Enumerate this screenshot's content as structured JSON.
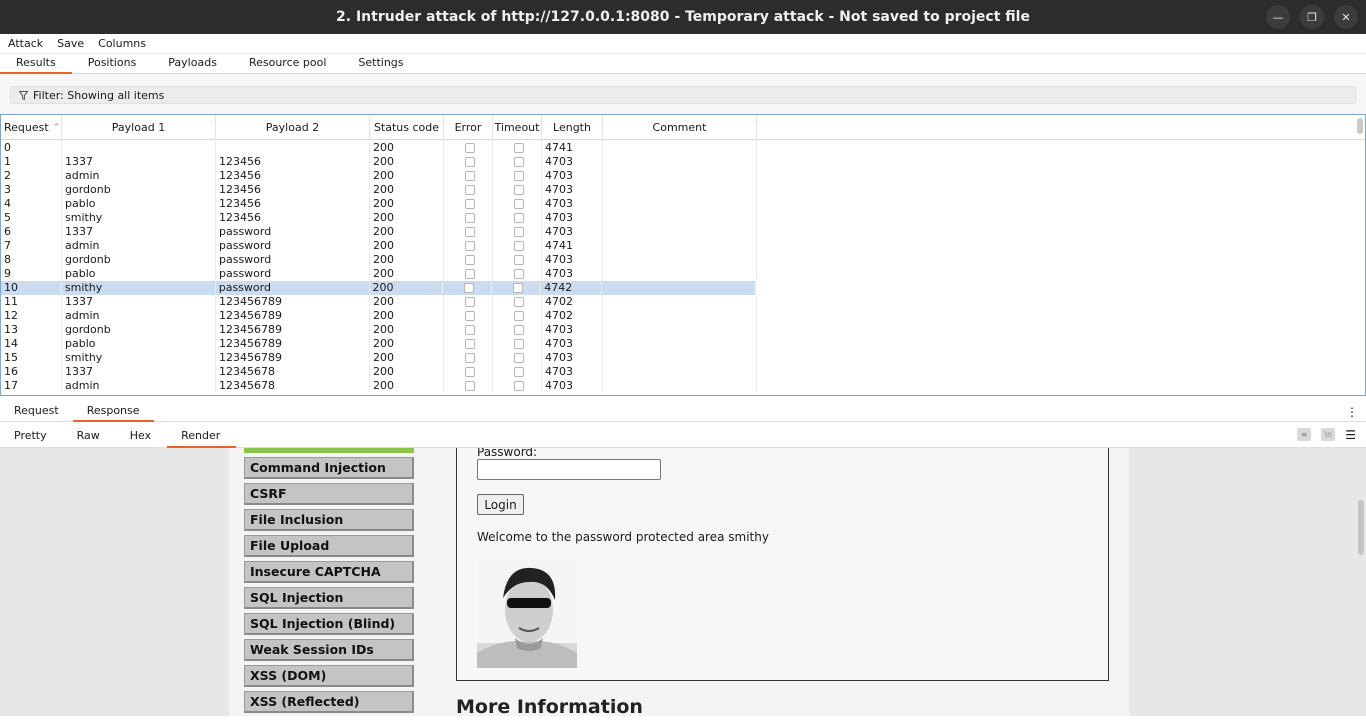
{
  "window": {
    "title": "2. Intruder attack of http://127.0.0.1:8080 - Temporary attack - Not saved to project file",
    "controls": [
      "minimize-icon",
      "restore-icon",
      "close-icon"
    ]
  },
  "menu": [
    "Attack",
    "Save",
    "Columns"
  ],
  "tabs": [
    "Results",
    "Positions",
    "Payloads",
    "Resource pool",
    "Settings"
  ],
  "filter": {
    "label": "Filter: Showing all items"
  },
  "table": {
    "columns": [
      "Request",
      "Payload 1",
      "Payload 2",
      "Status code",
      "Error",
      "Timeout",
      "Length",
      "Comment"
    ],
    "rows": [
      {
        "request": "0",
        "p1": "",
        "p2": "",
        "status": "200",
        "length": "4741"
      },
      {
        "request": "1",
        "p1": "1337",
        "p2": "123456",
        "status": "200",
        "length": "4703"
      },
      {
        "request": "2",
        "p1": "admin",
        "p2": "123456",
        "status": "200",
        "length": "4703"
      },
      {
        "request": "3",
        "p1": "gordonb",
        "p2": "123456",
        "status": "200",
        "length": "4703"
      },
      {
        "request": "4",
        "p1": "pablo",
        "p2": "123456",
        "status": "200",
        "length": "4703"
      },
      {
        "request": "5",
        "p1": "smithy",
        "p2": "123456",
        "status": "200",
        "length": "4703"
      },
      {
        "request": "6",
        "p1": "1337",
        "p2": "password",
        "status": "200",
        "length": "4703"
      },
      {
        "request": "7",
        "p1": "admin",
        "p2": "password",
        "status": "200",
        "length": "4741"
      },
      {
        "request": "8",
        "p1": "gordonb",
        "p2": "password",
        "status": "200",
        "length": "4703"
      },
      {
        "request": "9",
        "p1": "pablo",
        "p2": "password",
        "status": "200",
        "length": "4703"
      },
      {
        "request": "10",
        "p1": "smithy",
        "p2": "password",
        "status": "200",
        "length": "4742",
        "selected": true
      },
      {
        "request": "11",
        "p1": "1337",
        "p2": "123456789",
        "status": "200",
        "length": "4702"
      },
      {
        "request": "12",
        "p1": "admin",
        "p2": "123456789",
        "status": "200",
        "length": "4702"
      },
      {
        "request": "13",
        "p1": "gordonb",
        "p2": "123456789",
        "status": "200",
        "length": "4703"
      },
      {
        "request": "14",
        "p1": "pablo",
        "p2": "123456789",
        "status": "200",
        "length": "4703"
      },
      {
        "request": "15",
        "p1": "smithy",
        "p2": "123456789",
        "status": "200",
        "length": "4703"
      },
      {
        "request": "16",
        "p1": "1337",
        "p2": "12345678",
        "status": "200",
        "length": "4703"
      },
      {
        "request": "17",
        "p1": "admin",
        "p2": "12345678",
        "status": "200",
        "length": "4703"
      }
    ]
  },
  "reqresp_tabs": [
    "Request",
    "Response"
  ],
  "view_tabs": [
    "Pretty",
    "Raw",
    "Hex",
    "Render"
  ],
  "render": {
    "nav_items": [
      "Command Injection",
      "CSRF",
      "File Inclusion",
      "File Upload",
      "Insecure CAPTCHA",
      "SQL Injection",
      "SQL Injection (Blind)",
      "Weak Session IDs",
      "XSS (DOM)",
      "XSS (Reflected)"
    ],
    "password_label": "Password:",
    "login_button": "Login",
    "welcome_text": "Welcome to the password protected area smithy",
    "more_info_heading": "More Information"
  },
  "colors": {
    "accent": "#e8622c",
    "selected_row": "#cbdcf0",
    "titlebar": "#2c2c2c"
  }
}
